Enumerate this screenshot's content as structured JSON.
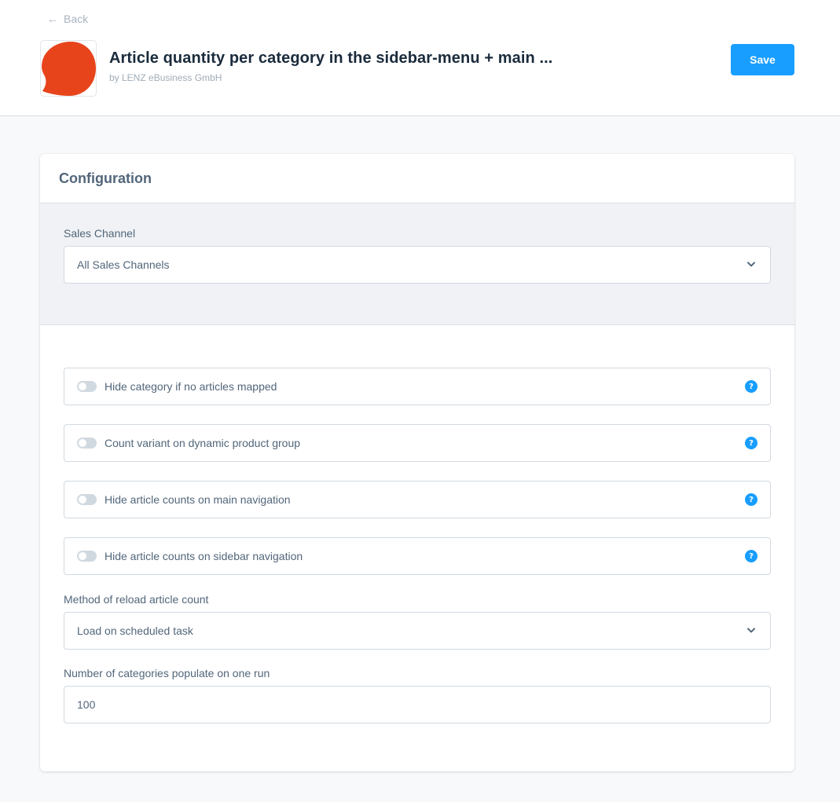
{
  "header": {
    "back_label": "Back",
    "plugin_title": "Article quantity per category in the sidebar-menu + main ...",
    "author": "by LENZ eBusiness GmbH",
    "save_label": "Save",
    "logo_color": "#e8441b"
  },
  "card": {
    "title": "Configuration",
    "sales_channel": {
      "label": "Sales Channel",
      "value": "All Sales Channels"
    },
    "toggles": [
      {
        "label": "Hide category if no articles mapped",
        "checked": false
      },
      {
        "label": "Count variant on dynamic product group",
        "checked": false
      },
      {
        "label": "Hide article counts on main navigation",
        "checked": false
      },
      {
        "label": "Hide article counts on sidebar navigation",
        "checked": false
      }
    ],
    "help_glyph": "?",
    "reload_method": {
      "label": "Method of reload article count",
      "value": "Load on scheduled task"
    },
    "categories_per_run": {
      "label": "Number of categories populate on one run",
      "value": "100"
    }
  },
  "colors": {
    "accent": "#189eff",
    "text": "#52667a",
    "title": "#1a2b3c"
  }
}
